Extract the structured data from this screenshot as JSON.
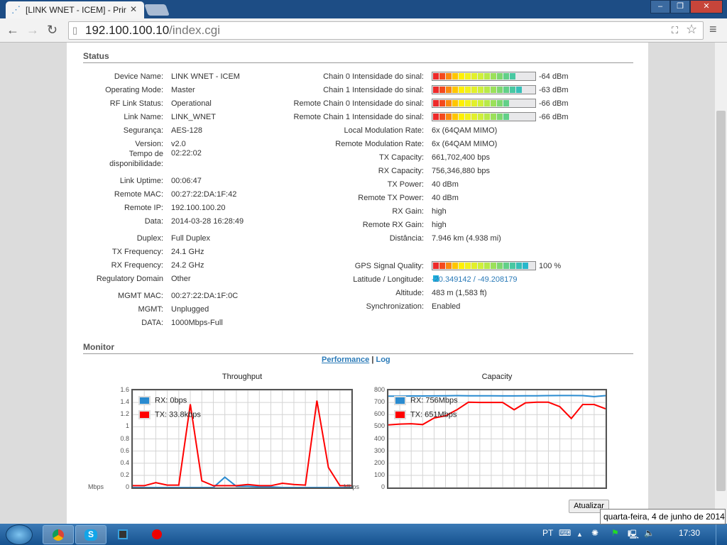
{
  "browser": {
    "tab_title": "[LINK WNET - ICEM] - Prir",
    "url_host": "192.100.100.10",
    "url_path": "/index.cgi"
  },
  "status": {
    "heading": "Status",
    "left": [
      {
        "label": "Device Name:",
        "value": "LINK WNET - ICEM"
      },
      {
        "label": "Operating Mode:",
        "value": "Master"
      },
      {
        "label": "RF Link Status:",
        "value": "Operational"
      },
      {
        "label": "Link Name:",
        "value": "LINK_WNET"
      },
      {
        "label": "Segurança:",
        "value": "AES-128"
      },
      {
        "label": "Version:",
        "value": "v2.0"
      },
      {
        "label": "Tempo de disponibilidade:",
        "value": "02:22:02"
      },
      {
        "label": "Link Uptime:",
        "value": "00:06:47"
      },
      {
        "label": "Remote MAC:",
        "value": "00:27:22:DA:1F:42"
      },
      {
        "label": "Remote IP:",
        "value": "192.100.100.20"
      },
      {
        "label": "Data:",
        "value": "2014-03-28 16:28:49"
      },
      {
        "label": "Duplex:",
        "value": "Full Duplex"
      },
      {
        "label": "TX Frequency:",
        "value": "24.1 GHz"
      },
      {
        "label": "RX Frequency:",
        "value": "24.2 GHz"
      },
      {
        "label": "Regulatory Domain",
        "value": "Other"
      },
      {
        "label": "MGMT MAC:",
        "value": "00:27:22:DA:1F:0C"
      },
      {
        "label": "MGMT:",
        "value": "Unplugged"
      },
      {
        "label": "DATA:",
        "value": "1000Mbps-Full"
      }
    ],
    "signals": [
      {
        "label": "Chain 0 Intensidade do sinal:",
        "value": "-64 dBm",
        "segments_lit": 13
      },
      {
        "label": "Chain 1 Intensidade do sinal:",
        "value": "-63 dBm",
        "segments_lit": 14
      },
      {
        "label": "Remote Chain 0 Intensidade do sinal:",
        "value": "-66 dBm",
        "segments_lit": 12
      },
      {
        "label": "Remote Chain 1 Intensidade do sinal:",
        "value": "-66 dBm",
        "segments_lit": 12
      }
    ],
    "segments_total": 16,
    "right": [
      {
        "label": "Local Modulation Rate:",
        "value": "6x (64QAM MIMO)"
      },
      {
        "label": "Remote Modulation Rate:",
        "value": "6x (64QAM MIMO)"
      },
      {
        "label": "TX Capacity:",
        "value": "661,702,400 bps"
      },
      {
        "label": "RX Capacity:",
        "value": "756,346,880 bps"
      },
      {
        "label": "TX Power:",
        "value": "40 dBm"
      },
      {
        "label": "Remote TX Power:",
        "value": "40 dBm"
      },
      {
        "label": "RX Gain:",
        "value": "high"
      },
      {
        "label": "Remote RX Gain:",
        "value": "high"
      },
      {
        "label": "Distância:",
        "value": "7.946 km (4.938 mi)"
      }
    ],
    "gps": {
      "label": "GPS Signal Quality:",
      "value": "100 %",
      "percent": 100
    },
    "right2": [
      {
        "label": "Latitude / Longitude:",
        "value": "-20.349142 / -49.208179"
      },
      {
        "label": "Altitude:",
        "value": "483 m (1,583 ft)"
      },
      {
        "label": "Synchronization:",
        "value": "Enabled"
      }
    ]
  },
  "monitor": {
    "heading": "Monitor",
    "performance_link": "Performance",
    "separator": "|",
    "log_link": "Log",
    "refresh_button": "Atualizar"
  },
  "chart_data": [
    {
      "type": "line",
      "title": "Throughput",
      "ylabel": "Mbps",
      "ylim": [
        0,
        1.6
      ],
      "yticks": [
        "0",
        "0.2",
        "0.4",
        "0.6",
        "0.8",
        "1",
        "1.2",
        "1.4",
        "1.6"
      ],
      "grid": true,
      "legend": "top-left",
      "series": [
        {
          "name": "RX: 0bps",
          "color": "#2a8bd0",
          "values": [
            0,
            0,
            0,
            0,
            0,
            0,
            0,
            0,
            0.17,
            0.02,
            0.02,
            0.01,
            0.01,
            0,
            0,
            0,
            0,
            0,
            0,
            0
          ]
        },
        {
          "name": "TX: 33.8kbps",
          "color": "#ff0000",
          "values": [
            0.03,
            0.03,
            0.08,
            0.04,
            0.04,
            1.37,
            0.11,
            0.03,
            0.03,
            0.03,
            0.05,
            0.03,
            0.03,
            0.07,
            0.05,
            0.04,
            1.43,
            0.33,
            0.03,
            0.03
          ]
        }
      ]
    },
    {
      "type": "line",
      "title": "Capacity",
      "ylabel": "Mbps",
      "ylim": [
        0,
        800
      ],
      "yticks": [
        "0",
        "100",
        "200",
        "300",
        "400",
        "500",
        "600",
        "700",
        "800"
      ],
      "grid": true,
      "legend": "top-left",
      "series": [
        {
          "name": "RX: 756Mbps",
          "color": "#2a8bd0",
          "values": [
            752,
            752,
            753,
            753,
            754,
            755,
            756,
            755,
            755,
            755,
            754,
            754,
            755,
            755,
            756,
            757,
            757,
            756,
            748,
            756
          ]
        },
        {
          "name": "TX: 651Mbps",
          "color": "#ff0000",
          "values": [
            515,
            522,
            525,
            518,
            572,
            590,
            640,
            702,
            700,
            700,
            700,
            640,
            697,
            702,
            702,
            665,
            568,
            683,
            683,
            648
          ]
        }
      ]
    }
  ],
  "taskbar": {
    "language": "PT",
    "clock": "17:30",
    "date_tooltip": "quarta-feira, 4 de junho de 2014"
  }
}
